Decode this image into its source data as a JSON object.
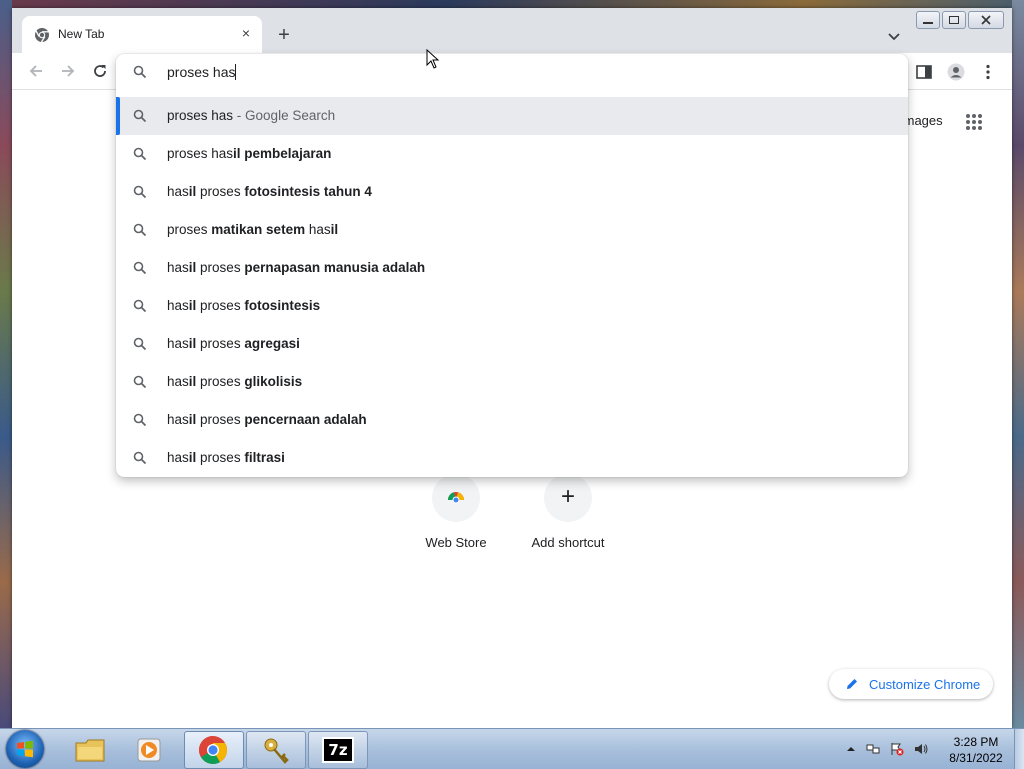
{
  "browser": {
    "tab_title": "New Tab",
    "new_tab_symbol": "+",
    "close_symbol": "×"
  },
  "omnibox": {
    "text": "proses has",
    "suggestions": [
      {
        "parts": [
          {
            "t": "proses has",
            "b": false
          }
        ],
        "suffix": " - Google Search"
      },
      {
        "parts": [
          {
            "t": "proses has",
            "b": false
          },
          {
            "t": "il pembelajaran",
            "b": true
          }
        ]
      },
      {
        "parts": [
          {
            "t": "has",
            "b": false
          },
          {
            "t": "il",
            "b": true
          },
          {
            "t": " proses ",
            "b": false
          },
          {
            "t": "fotosintesis tahun 4",
            "b": true
          }
        ]
      },
      {
        "parts": [
          {
            "t": "proses ",
            "b": false
          },
          {
            "t": "matikan setem",
            "b": true
          },
          {
            "t": " has",
            "b": false
          },
          {
            "t": "il",
            "b": true
          }
        ]
      },
      {
        "parts": [
          {
            "t": "has",
            "b": false
          },
          {
            "t": "il",
            "b": true
          },
          {
            "t": " proses ",
            "b": false
          },
          {
            "t": "pernapasan manusia adalah",
            "b": true
          }
        ]
      },
      {
        "parts": [
          {
            "t": "has",
            "b": false
          },
          {
            "t": "il",
            "b": true
          },
          {
            "t": " proses ",
            "b": false
          },
          {
            "t": "fotosintesis",
            "b": true
          }
        ]
      },
      {
        "parts": [
          {
            "t": "has",
            "b": false
          },
          {
            "t": "il",
            "b": true
          },
          {
            "t": " proses ",
            "b": false
          },
          {
            "t": "agregasi",
            "b": true
          }
        ]
      },
      {
        "parts": [
          {
            "t": "has",
            "b": false
          },
          {
            "t": "il",
            "b": true
          },
          {
            "t": " proses ",
            "b": false
          },
          {
            "t": "glikolisis",
            "b": true
          }
        ]
      },
      {
        "parts": [
          {
            "t": "has",
            "b": false
          },
          {
            "t": "il",
            "b": true
          },
          {
            "t": " proses ",
            "b": false
          },
          {
            "t": "pencernaan adalah",
            "b": true
          }
        ]
      },
      {
        "parts": [
          {
            "t": "has",
            "b": false
          },
          {
            "t": "il",
            "b": true
          },
          {
            "t": " proses ",
            "b": false
          },
          {
            "t": "filtrasi",
            "b": true
          }
        ]
      }
    ]
  },
  "ntp": {
    "images_link": "Images",
    "shortcuts": [
      {
        "label": "Web Store"
      },
      {
        "label": "Add shortcut",
        "symbol": "+"
      }
    ],
    "customize_label": "Customize Chrome"
  },
  "taskbar": {
    "clock_time": "3:28 PM",
    "clock_date": "8/31/2022",
    "sevenzip_label": "7z"
  },
  "colors": {
    "accent": "#1a73e8",
    "selected_row": "#e8eaed"
  }
}
